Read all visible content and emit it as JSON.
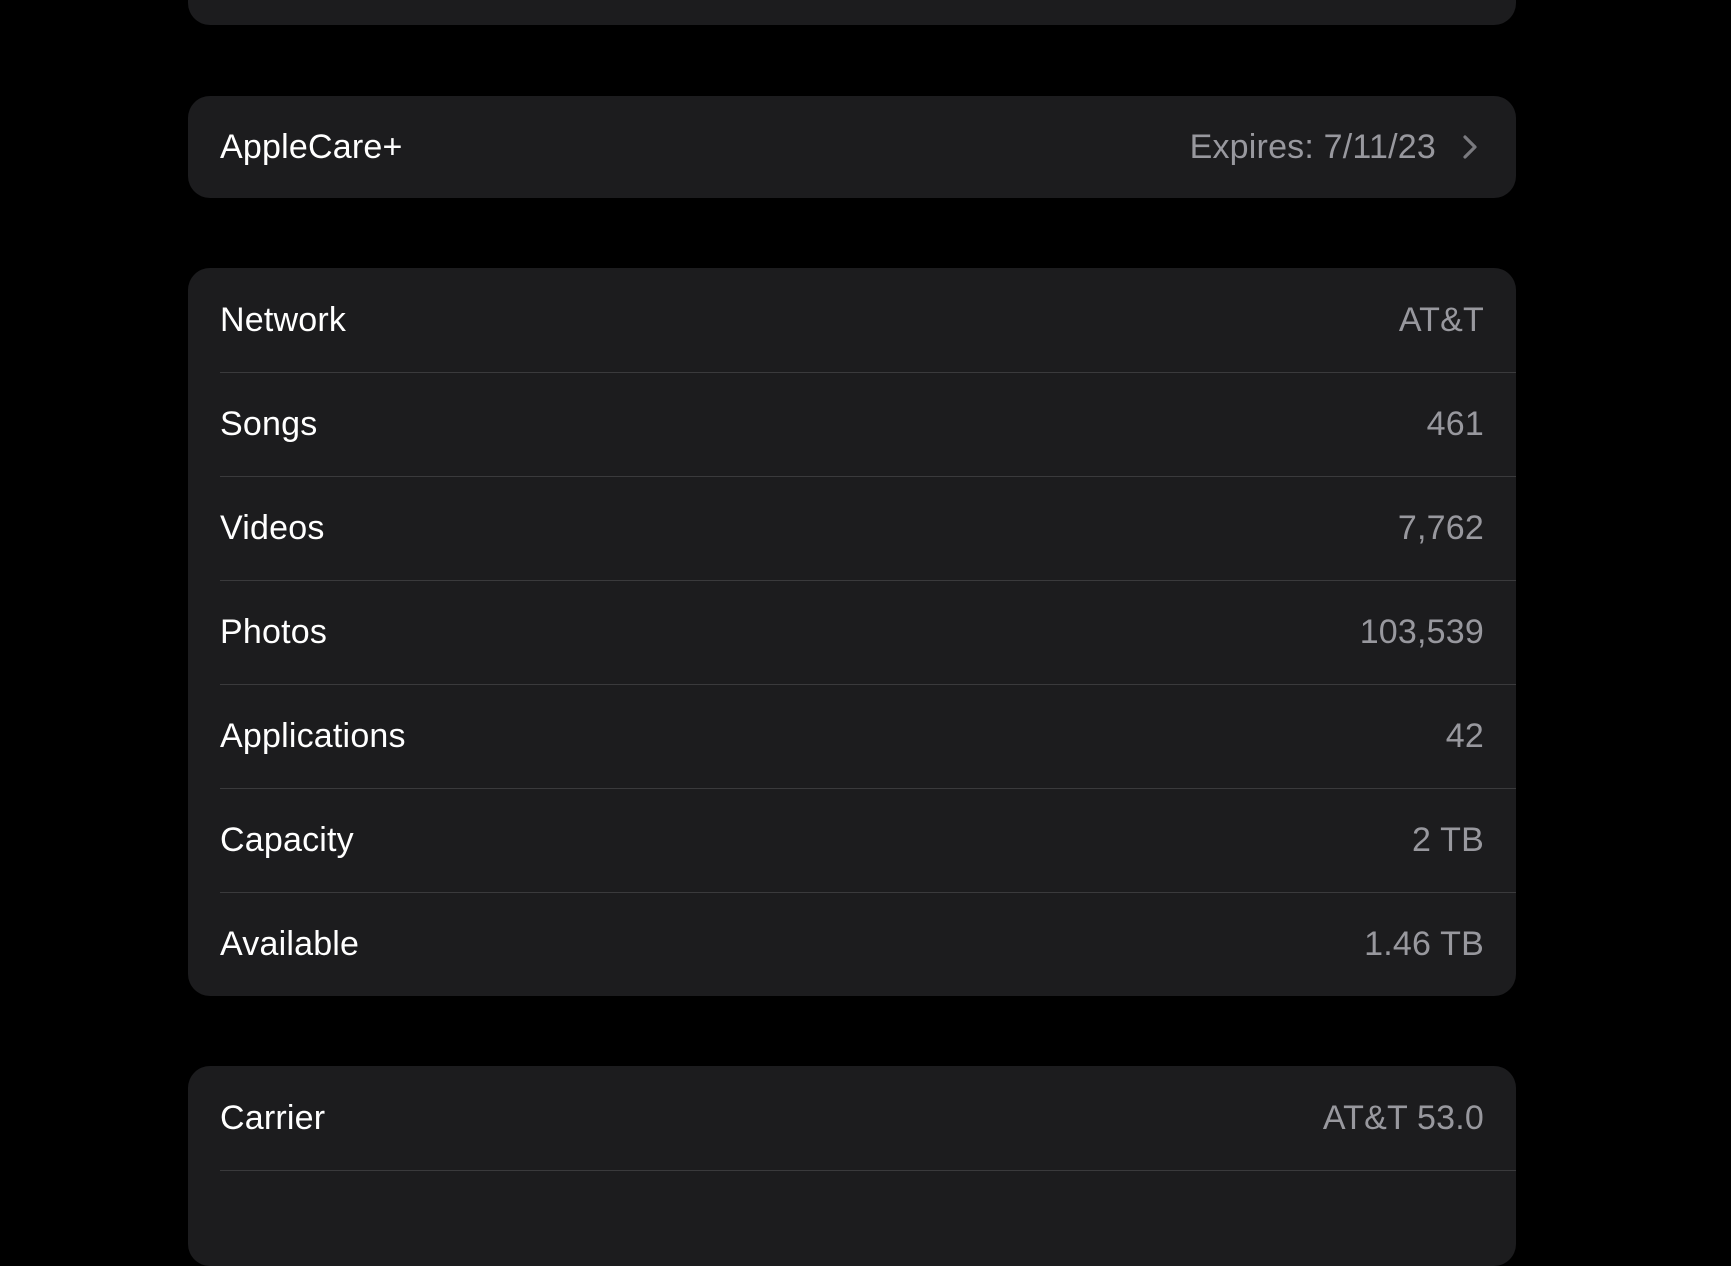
{
  "applecare": {
    "label": "AppleCare+",
    "value": "Expires: 7/11/23",
    "icon": "chevron-right-icon"
  },
  "about": {
    "rows": [
      {
        "label": "Network",
        "value": "AT&T"
      },
      {
        "label": "Songs",
        "value": "461"
      },
      {
        "label": "Videos",
        "value": "7,762"
      },
      {
        "label": "Photos",
        "value": "103,539"
      },
      {
        "label": "Applications",
        "value": "42"
      },
      {
        "label": "Capacity",
        "value": "2 TB"
      },
      {
        "label": "Available",
        "value": "1.46 TB"
      }
    ]
  },
  "carrier": {
    "label": "Carrier",
    "value": "AT&T 53.0"
  },
  "colors": {
    "background": "#000000",
    "cell": "#1c1c1e",
    "separator": "#3a3a3c",
    "label": "#ffffff",
    "value": "#98989e"
  }
}
